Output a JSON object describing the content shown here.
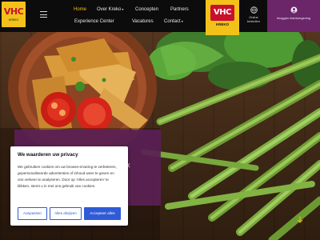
{
  "header": {
    "logo": {
      "brand": "VHC",
      "sub": "KREKO"
    },
    "nav": [
      {
        "label": "Home",
        "active": true
      },
      {
        "label": "Over Kreko",
        "dropdown": true
      },
      {
        "label": "Concepten"
      },
      {
        "label": "Partners"
      },
      {
        "label": "Experience Center"
      },
      {
        "label": "Vacatures"
      },
      {
        "label": "Contact",
        "dropdown": true
      }
    ],
    "center_logo": {
      "brand": "VHC",
      "sub": "KREKO"
    },
    "order": {
      "label_line1": "Online",
      "label_line2": "bestellen",
      "icon": "globe-icon"
    },
    "login": {
      "label": "Inloggen klantomgeving",
      "icon": "user-icon"
    }
  },
  "consent": {
    "title": "We waarderen uw privacy",
    "body": "We gebruiken cookies om uw browse-ervaring te verbeteren, gepersonaliseerde advertenties of inhoud weer te geven en ons verkeer te analyseren. Door op 'Alles accepteren' te klikken, stemt u in met ons gebruik van cookies.",
    "buttons": {
      "customize": "Aanpassen",
      "reject": "Alles afwijzen",
      "accept": "Accepteer alles"
    }
  },
  "colors": {
    "brand_yellow": "#f2c21a",
    "brand_red": "#c8102e",
    "login_purple": "#6b2569",
    "button_blue": "#2f5bd6"
  }
}
